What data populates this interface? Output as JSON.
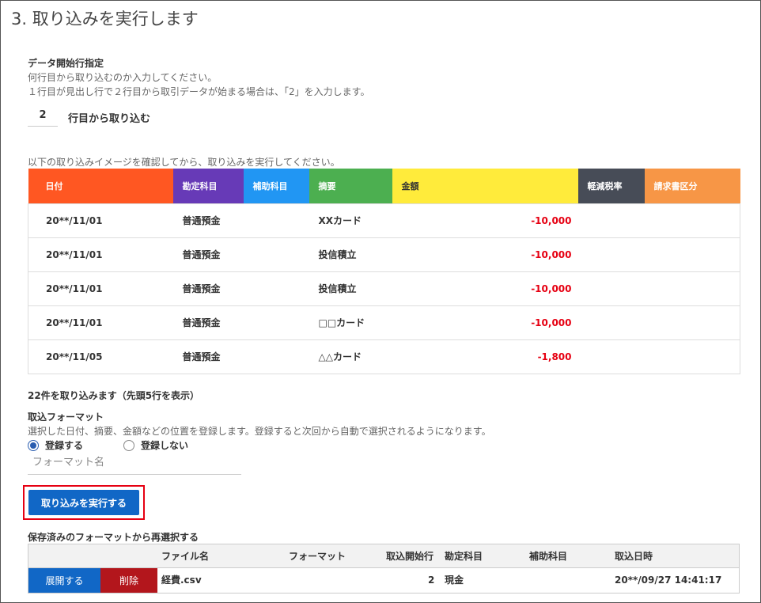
{
  "step_title": "3. 取り込みを実行します",
  "start_row": {
    "heading": "データ開始行指定",
    "desc1": "何行目から取り込むのか入力してください。",
    "desc2": "１行目が見出し行で２行目から取引データが始まる場合は、「2」を入力します。",
    "value": "2",
    "suffix": "行目から取り込む"
  },
  "preview": {
    "instruction": "以下の取り込みイメージを確認してから、取り込みを実行してください。",
    "columns": [
      {
        "label": "日付",
        "color": "#ff5722"
      },
      {
        "label": "勘定科目",
        "color": "#673ab7"
      },
      {
        "label": "補助科目",
        "color": "#2196f3"
      },
      {
        "label": "摘要",
        "color": "#4caf50"
      },
      {
        "label": "金額",
        "color": "#ffeb3b"
      },
      {
        "label": "軽減税率",
        "color": "#474c57"
      },
      {
        "label": "請求書区分",
        "color": "#f79646"
      }
    ],
    "rows": [
      {
        "date": "20**/11/01",
        "account": "普通預金",
        "sub": "",
        "summary": "XXカード",
        "amount": "-10,000",
        "tax": "",
        "invoice": ""
      },
      {
        "date": "20**/11/01",
        "account": "普通預金",
        "sub": "",
        "summary": "投信積立",
        "amount": "-10,000",
        "tax": "",
        "invoice": ""
      },
      {
        "date": "20**/11/01",
        "account": "普通預金",
        "sub": "",
        "summary": "投信積立",
        "amount": "-10,000",
        "tax": "",
        "invoice": ""
      },
      {
        "date": "20**/11/01",
        "account": "普通預金",
        "sub": "",
        "summary": "□□カード",
        "amount": "-10,000",
        "tax": "",
        "invoice": ""
      },
      {
        "date": "20**/11/05",
        "account": "普通預金",
        "sub": "",
        "summary": "△△カード",
        "amount": "-1,800",
        "tax": "",
        "invoice": ""
      }
    ],
    "count_text": "22件を取り込みます（先頭5行を表示）"
  },
  "format": {
    "heading": "取込フォーマット",
    "desc": "選択した日付、摘要、金額などの位置を登録します。登録すると次回から自動で選択されるようになります。",
    "radio_register": "登録する",
    "radio_no_register": "登録しない",
    "name_placeholder": "フォーマット名"
  },
  "execute_button": "取り込みを実行する",
  "saved": {
    "heading": "保存済みのフォーマットから再選択する",
    "headers": {
      "file": "ファイル名",
      "format": "フォーマット",
      "start": "取込開始行",
      "account": "勘定科目",
      "sub": "補助科目",
      "date": "取込日時"
    },
    "row": {
      "expand": "展開する",
      "delete": "削除",
      "file": "経費.csv",
      "format": "",
      "start": "2",
      "account": "現金",
      "sub": "",
      "date": "20**/09/27 14:41:17"
    }
  }
}
